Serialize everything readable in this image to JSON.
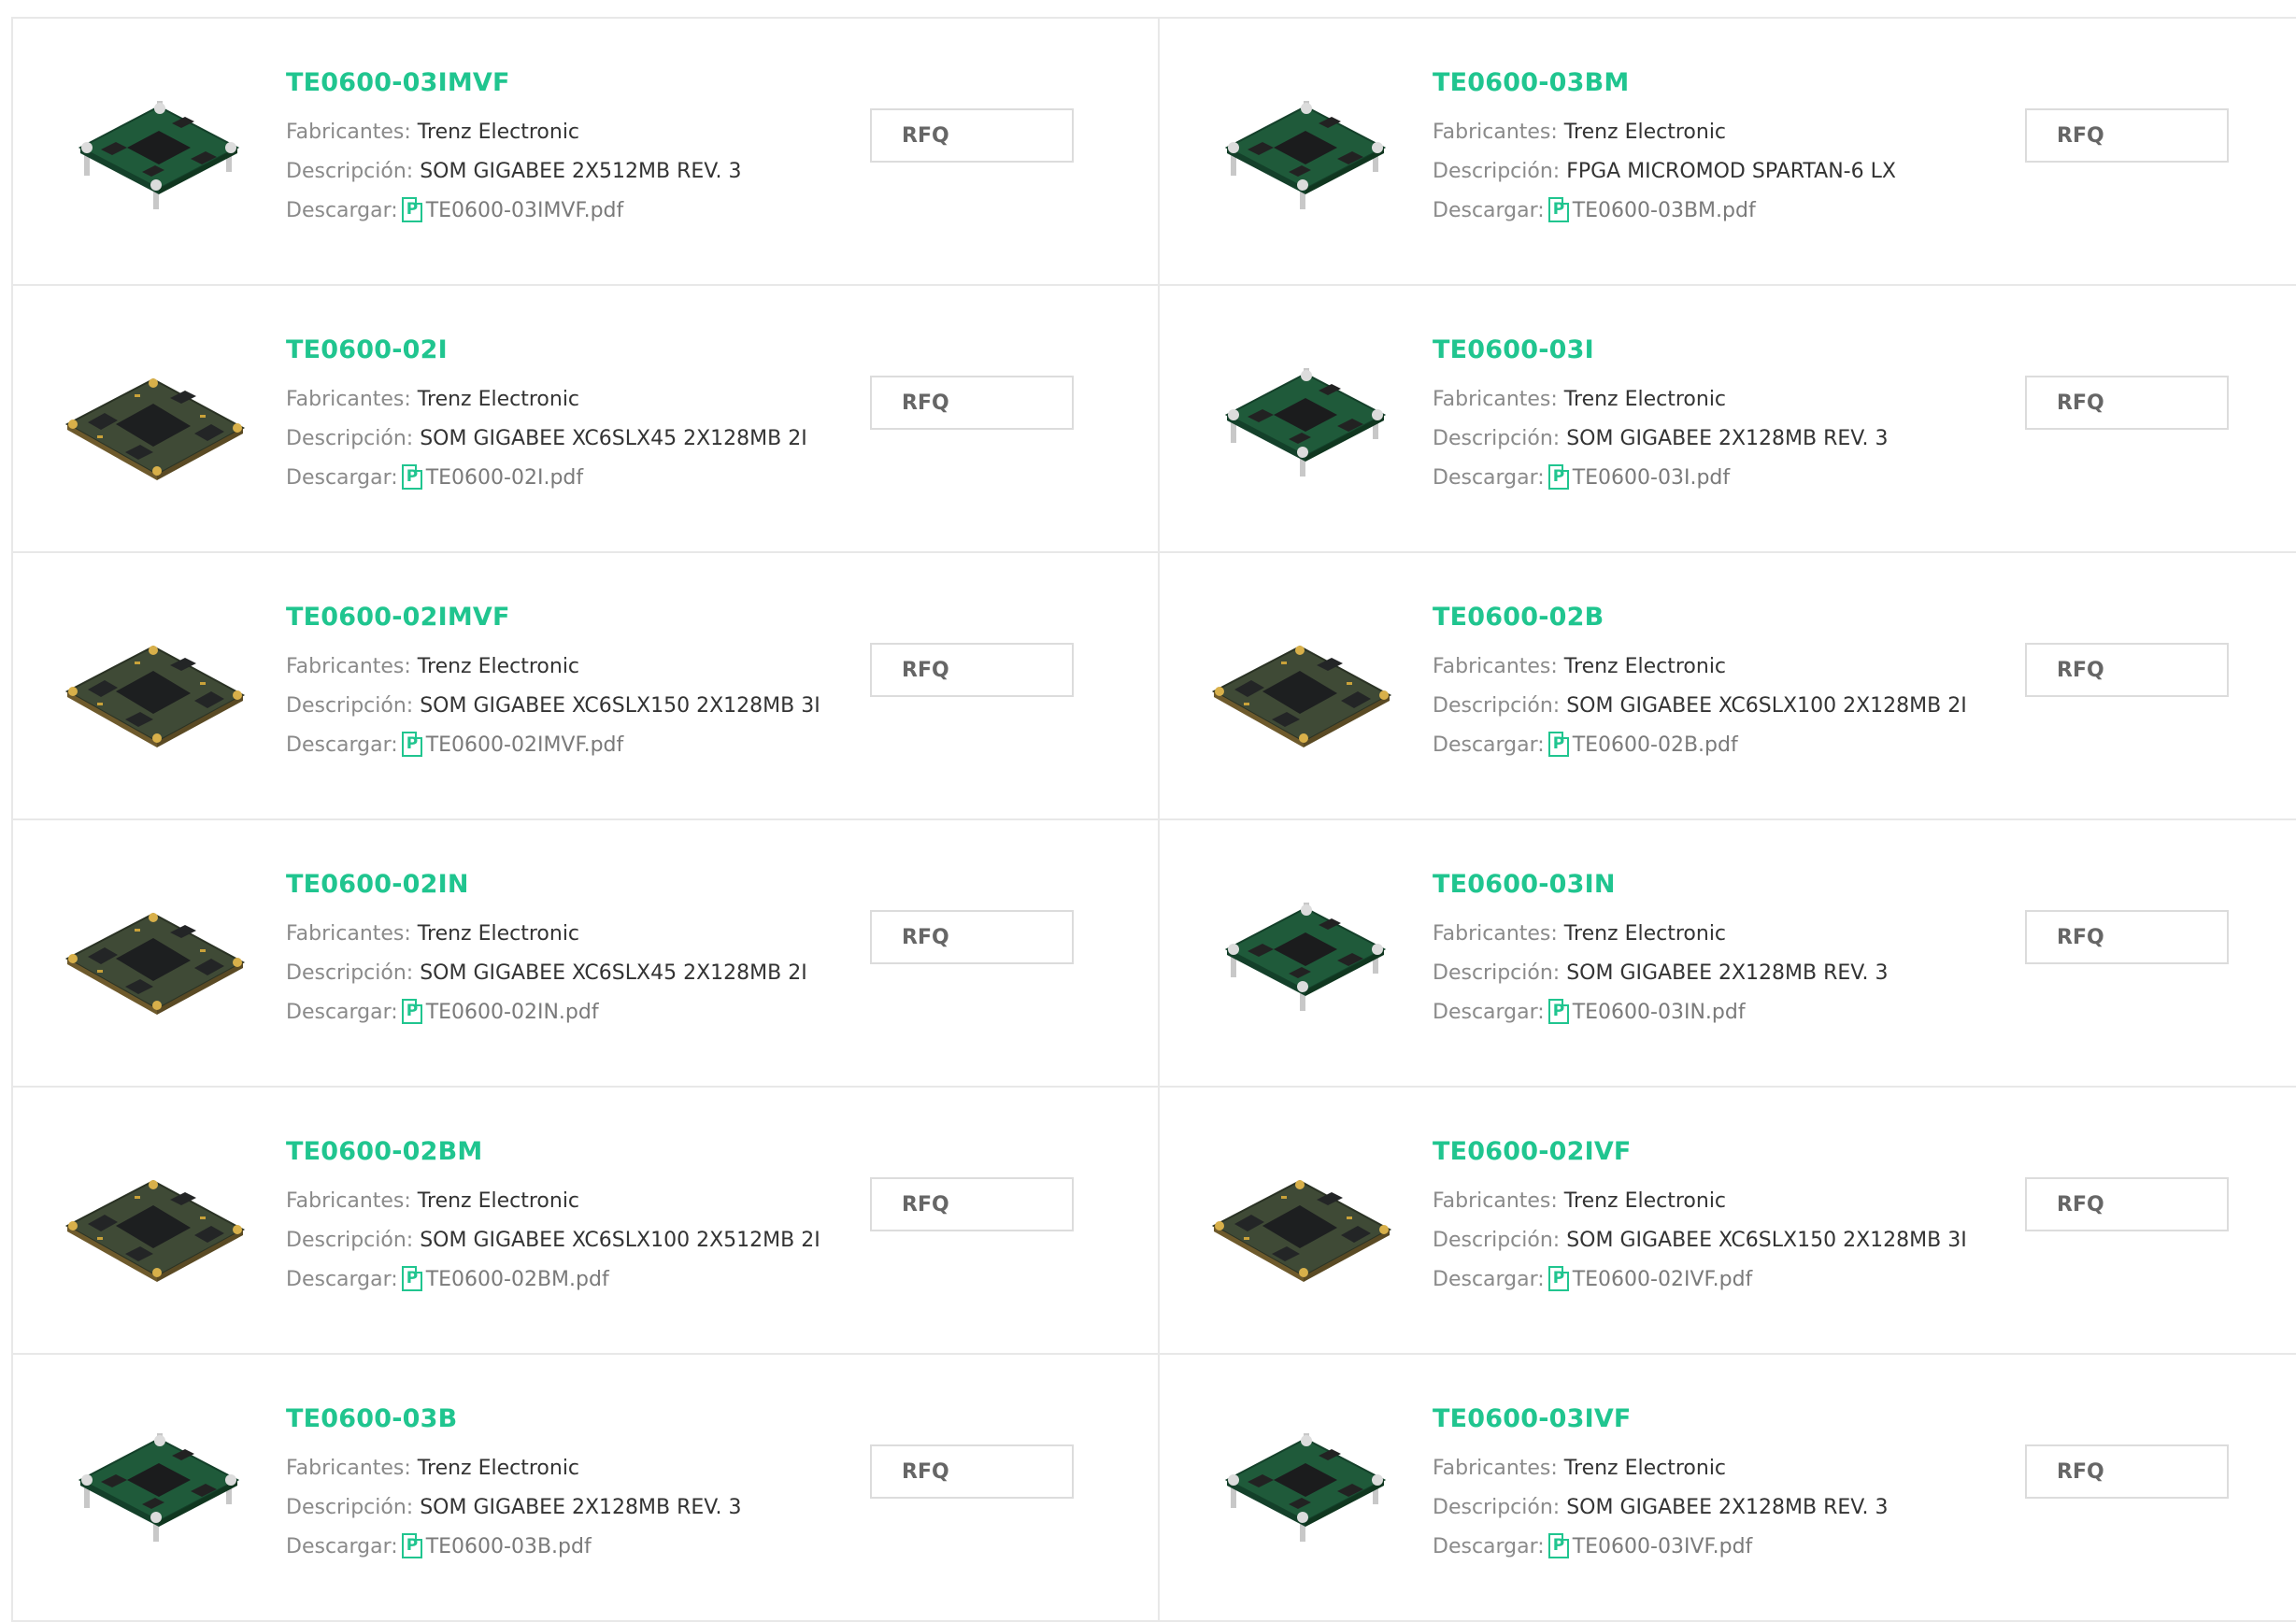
{
  "labels": {
    "manufacturer": "Fabricantes:",
    "description": "Descripción:",
    "download": "Descargar:",
    "rfq": "RFQ"
  },
  "icons": {
    "pdf": "pdf-icon",
    "product": "pcb-board-image"
  },
  "colors": {
    "accent": "#20c58f",
    "label": "#8a8a8a",
    "value": "#333333",
    "border": "#e8e8e8"
  },
  "products": [
    {
      "part": "TE0600-03IMVF",
      "manufacturer": "Trenz Electronic",
      "description": "SOM GIGABEE 2X512MB REV. 3",
      "pdf": "TE0600-03IMVF.pdf",
      "board": "rev3"
    },
    {
      "part": "TE0600-03BM",
      "manufacturer": "Trenz Electronic",
      "description": "FPGA MICROMOD SPARTAN-6 LX",
      "pdf": "TE0600-03BM.pdf",
      "board": "rev3"
    },
    {
      "part": "TE0600-02I",
      "manufacturer": "Trenz Electronic",
      "description": "SOM GIGABEE XC6SLX45 2X128MB 2I",
      "pdf": "TE0600-02I.pdf",
      "board": "rev2"
    },
    {
      "part": "TE0600-03I",
      "manufacturer": "Trenz Electronic",
      "description": "SOM GIGABEE 2X128MB REV. 3",
      "pdf": "TE0600-03I.pdf",
      "board": "rev3"
    },
    {
      "part": "TE0600-02IMVF",
      "manufacturer": "Trenz Electronic",
      "description": "SOM GIGABEE XC6SLX150 2X128MB 3I",
      "pdf": "TE0600-02IMVF.pdf",
      "board": "rev2"
    },
    {
      "part": "TE0600-02B",
      "manufacturer": "Trenz Electronic",
      "description": "SOM GIGABEE XC6SLX100 2X128MB 2I",
      "pdf": "TE0600-02B.pdf",
      "board": "rev2"
    },
    {
      "part": "TE0600-02IN",
      "manufacturer": "Trenz Electronic",
      "description": "SOM GIGABEE XC6SLX45 2X128MB 2I",
      "pdf": "TE0600-02IN.pdf",
      "board": "rev2"
    },
    {
      "part": "TE0600-03IN",
      "manufacturer": "Trenz Electronic",
      "description": "SOM GIGABEE 2X128MB REV. 3",
      "pdf": "TE0600-03IN.pdf",
      "board": "rev3"
    },
    {
      "part": "TE0600-02BM",
      "manufacturer": "Trenz Electronic",
      "description": "SOM GIGABEE XC6SLX100 2X512MB 2I",
      "pdf": "TE0600-02BM.pdf",
      "board": "rev2"
    },
    {
      "part": "TE0600-02IVF",
      "manufacturer": "Trenz Electronic",
      "description": "SOM GIGABEE XC6SLX150 2X128MB 3I",
      "pdf": "TE0600-02IVF.pdf",
      "board": "rev2"
    },
    {
      "part": "TE0600-03B",
      "manufacturer": "Trenz Electronic",
      "description": "SOM GIGABEE 2X128MB REV. 3",
      "pdf": "TE0600-03B.pdf",
      "board": "rev3"
    },
    {
      "part": "TE0600-03IVF",
      "manufacturer": "Trenz Electronic",
      "description": "SOM GIGABEE 2X128MB REV. 3",
      "pdf": "TE0600-03IVF.pdf",
      "board": "rev3"
    }
  ]
}
